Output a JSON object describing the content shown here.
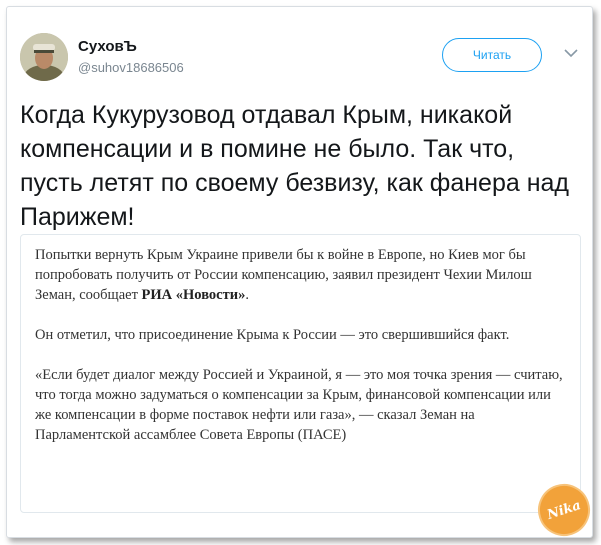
{
  "author": {
    "name": "СуховЪ",
    "handle": "@suhov18686506"
  },
  "follow_button": {
    "label": "Читать"
  },
  "tweet": {
    "text": "Когда Кукурузовод отдавал Крым, никакой компенсации и в помине не было. Так что, пусть летят по своему безвизу, как фанера над Парижем!"
  },
  "quoted_card": {
    "paragraph1_before": "Попытки вернуть Крым Украине привели бы к войне в Европе, но Киев мог бы попробовать получить от России компенсацию, заявил президент Чехии Милош Земан, сообщает ",
    "paragraph1_source": "РИА «Новости»",
    "paragraph1_after": ".",
    "paragraph2": "Он отметил, что присоединение Крыма к России — это свершившийся факт.",
    "paragraph3": "«Если будет диалог между Россией и Украиной, я — это моя точка зрения — считаю, что тогда можно задуматься о компенсации за Крым, финансовой компенсации или же компенсации в форме поставок нефти или газа», — сказал Земан на Парламентской ассамблее Совета Европы (ПАСЕ)"
  },
  "watermark": {
    "text": "Nika"
  },
  "colors": {
    "accent": "#1da1f2",
    "text": "#14171a",
    "muted": "#7a8690"
  }
}
